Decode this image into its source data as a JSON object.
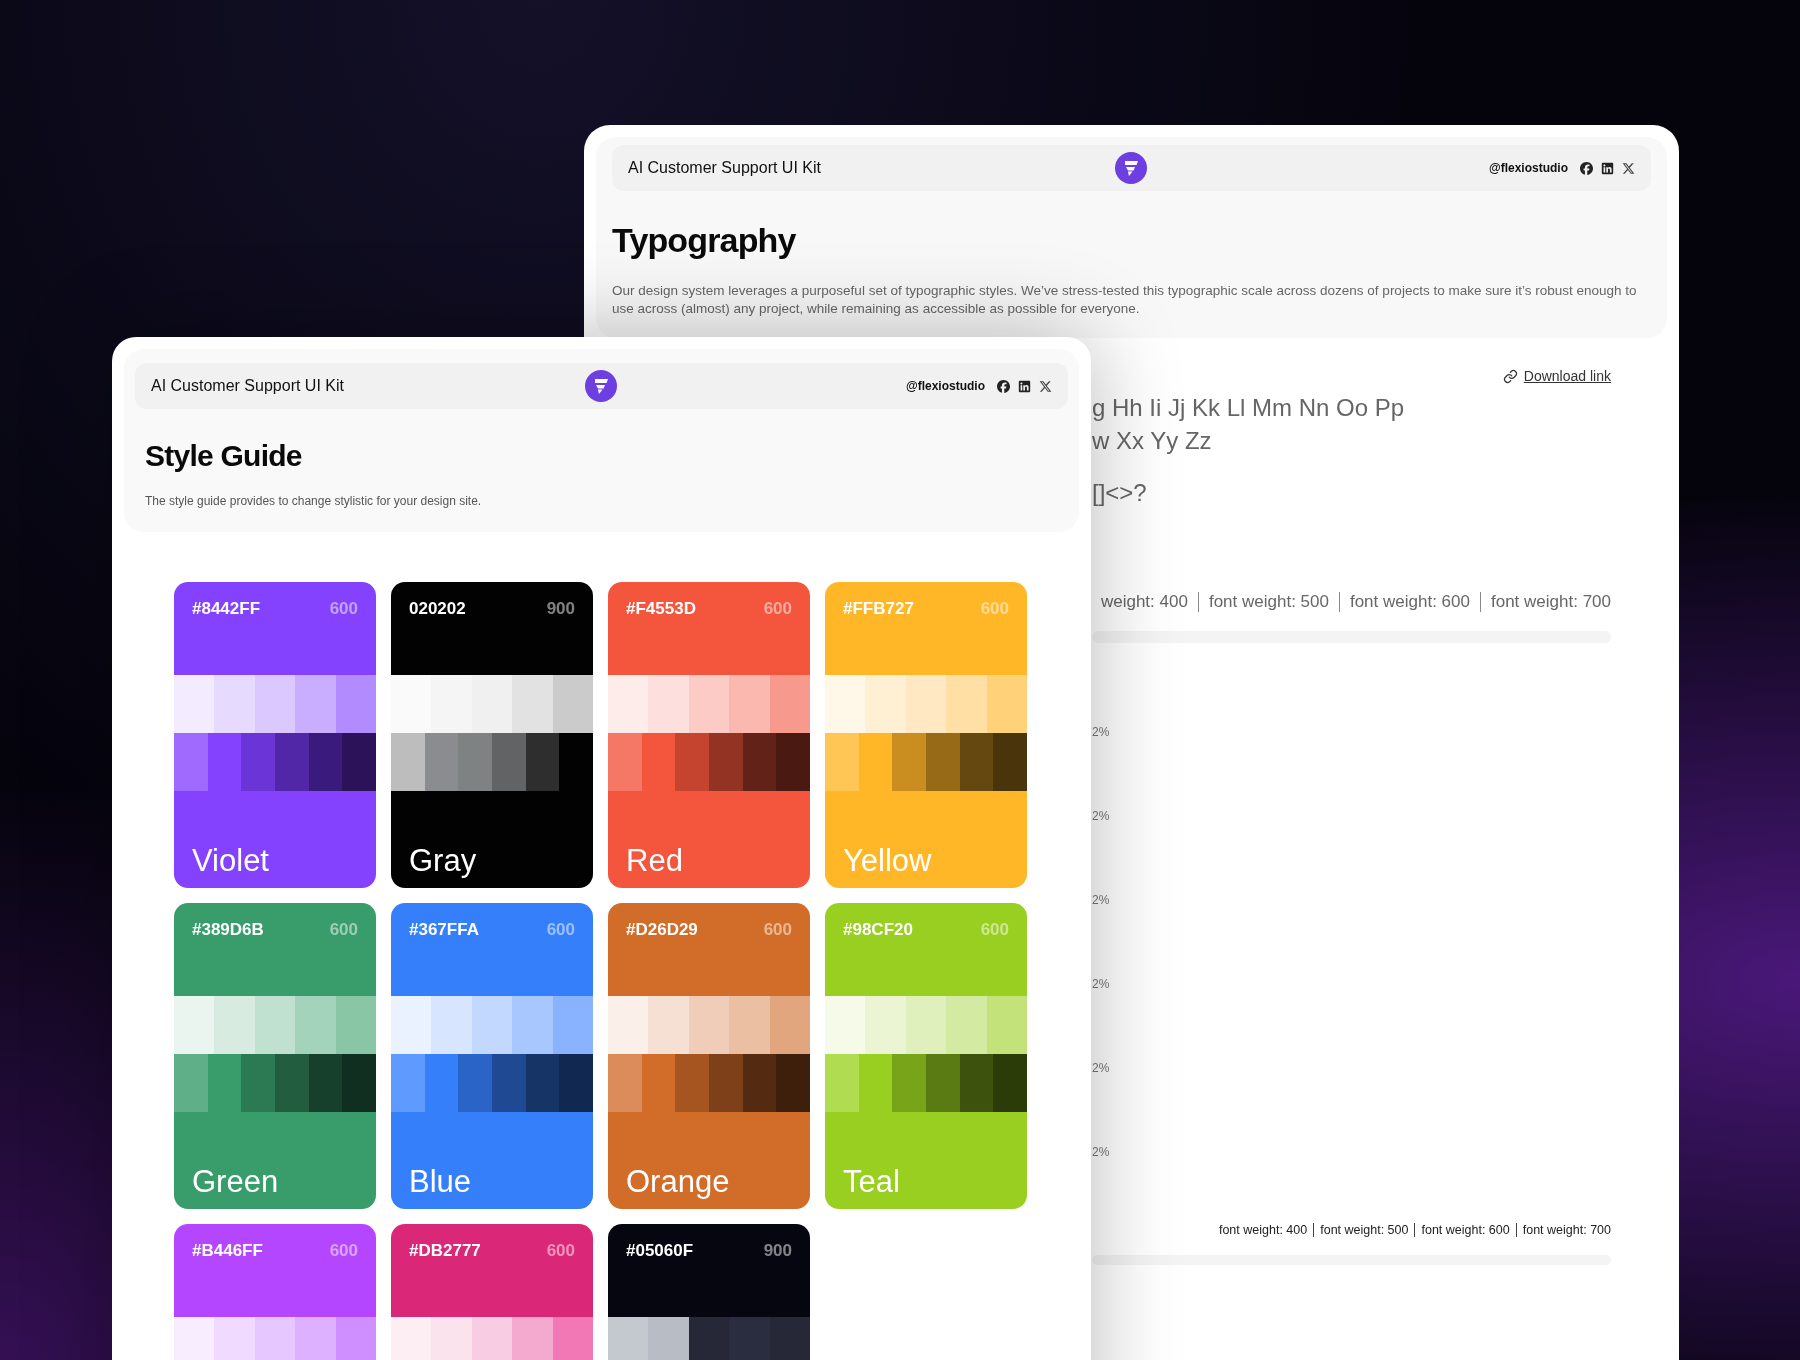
{
  "typography_window": {
    "header": {
      "title": "AI Customer Support UI Kit",
      "handle": "@flexiostudio"
    },
    "title": "Typography",
    "description": "Our design system leverages a purposeful set of typographic styles. We’ve stress-tested this typographic scale across dozens of projects to make sure it’s robust enough to use across (almost) any project, while remaining as accessible as possible for everyone.",
    "download_link": "Download link",
    "alphabet_lines": [
      "g Hh Ii Jj Kk Ll Mm Nn Oo Pp",
      "w Xx Yy Zz"
    ],
    "symbols": "[]<>?",
    "weights_large": [
      "weight: 400",
      "font weight: 500",
      "font weight: 600",
      "font weight: 700"
    ],
    "scale_percentages": [
      "2%",
      "2%",
      "2%",
      "2%",
      "2%",
      "2%"
    ],
    "weights_small": [
      "font weight: 400",
      "font weight: 500",
      "font weight: 600",
      "font weight: 700"
    ]
  },
  "style_guide_window": {
    "header": {
      "title": "AI Customer Support UI Kit",
      "handle": "@flexiostudio"
    },
    "title": "Style Guide",
    "description": "The style guide provides to change stylistic for your design site.",
    "swatches": [
      {
        "hex": "#8442FF",
        "weight": "600",
        "name": "Violet",
        "color": "#8442ff",
        "light_shades": [
          {
            "color": "#f3ebff"
          },
          {
            "color": "#e6daff"
          },
          {
            "color": "#dac8ff"
          },
          {
            "color": "#c9aeff"
          },
          {
            "color": "#b28cff"
          }
        ],
        "dark_shades": [
          {
            "color": "#a06aff"
          },
          {
            "color": "#8442ff"
          },
          {
            "color": "#6b34d6"
          },
          {
            "color": "#5127a8"
          },
          {
            "color": "#3b1a7d"
          },
          {
            "color": "#2b1259"
          }
        ]
      },
      {
        "hex": "020202",
        "weight": "900",
        "name": "Gray",
        "color": "#020202",
        "light_shades": [
          {
            "color": "#fafafa"
          },
          {
            "color": "#f5f5f5"
          },
          {
            "color": "#f0f0f0"
          },
          {
            "color": "#e2e2e2"
          },
          {
            "color": "#cbcbcb"
          }
        ],
        "dark_shades": [
          {
            "color": "#bdbdbd"
          },
          {
            "color": "#8a8c90"
          },
          {
            "color": "#7f8282"
          },
          {
            "color": "#626364"
          },
          {
            "color": "#2e2e2e"
          },
          {
            "color": "#020202"
          }
        ]
      },
      {
        "hex": "#F4553D",
        "weight": "600",
        "name": "Red",
        "color": "#f4553d",
        "light_shades": [
          {
            "color": "#feeceb"
          },
          {
            "color": "#fde0dd"
          },
          {
            "color": "#fccbc6"
          },
          {
            "color": "#fab8ae"
          },
          {
            "color": "#f7998c"
          }
        ],
        "dark_shades": [
          {
            "color": "#f57765"
          },
          {
            "color": "#f4553d"
          },
          {
            "color": "#c44430"
          },
          {
            "color": "#923324"
          },
          {
            "color": "#622218"
          },
          {
            "color": "#4a1912"
          }
        ]
      },
      {
        "hex": "#FFB727",
        "weight": "600",
        "name": "Yellow",
        "color": "#ffb727",
        "light_shades": [
          {
            "color": "#fff8e8"
          },
          {
            "color": "#fff0d4"
          },
          {
            "color": "#ffe8c2"
          },
          {
            "color": "#ffdfa4"
          },
          {
            "color": "#ffd27a"
          }
        ],
        "dark_shades": [
          {
            "color": "#ffc655"
          },
          {
            "color": "#ffb727"
          },
          {
            "color": "#c98e1f"
          },
          {
            "color": "#966a17"
          },
          {
            "color": "#654710"
          },
          {
            "color": "#4a340b"
          }
        ]
      },
      {
        "hex": "#389D6B",
        "weight": "600",
        "name": "Green",
        "color": "#389d6b",
        "light_shades": [
          {
            "color": "#ebf5ef"
          },
          {
            "color": "#d7ebe1"
          },
          {
            "color": "#c0e1d0"
          },
          {
            "color": "#a4d3bb"
          },
          {
            "color": "#88c6a6"
          }
        ],
        "dark_shades": [
          {
            "color": "#5fb088"
          },
          {
            "color": "#389d6b"
          },
          {
            "color": "#2b7a53"
          },
          {
            "color": "#225d40"
          },
          {
            "color": "#17402c"
          },
          {
            "color": "#112f20"
          }
        ]
      },
      {
        "hex": "#367FFA",
        "weight": "600",
        "name": "Blue",
        "color": "#367ffa",
        "light_shades": [
          {
            "color": "#ebf2ff"
          },
          {
            "color": "#d7e5ff"
          },
          {
            "color": "#c3d8ff"
          },
          {
            "color": "#a8c7ff"
          },
          {
            "color": "#89b2ff"
          }
        ],
        "dark_shades": [
          {
            "color": "#5e9aff"
          },
          {
            "color": "#367ffa"
          },
          {
            "color": "#2a64c6"
          },
          {
            "color": "#1f4a93"
          },
          {
            "color": "#163566"
          },
          {
            "color": "#112850"
          }
        ]
      },
      {
        "hex": "#D26D29",
        "weight": "600",
        "name": "Orange",
        "color": "#d26d29",
        "light_shades": [
          {
            "color": "#fbefe9"
          },
          {
            "color": "#f6e0d3"
          },
          {
            "color": "#f0cdb8"
          },
          {
            "color": "#eabfa2"
          },
          {
            "color": "#e2a67e"
          }
        ],
        "dark_shades": [
          {
            "color": "#dc8b5a"
          },
          {
            "color": "#d26d29"
          },
          {
            "color": "#a75520"
          },
          {
            "color": "#7d4018"
          },
          {
            "color": "#542b10"
          },
          {
            "color": "#3d1f0b"
          }
        ]
      },
      {
        "hex": "#98CF20",
        "weight": "600",
        "name": "Teal",
        "color": "#98cf20",
        "light_shades": [
          {
            "color": "#f6fae9"
          },
          {
            "color": "#ebf5d3"
          },
          {
            "color": "#e0f0bd"
          },
          {
            "color": "#d3eaa2"
          },
          {
            "color": "#c3e37a"
          }
        ],
        "dark_shades": [
          {
            "color": "#b0dc52"
          },
          {
            "color": "#98cf20"
          },
          {
            "color": "#78a419"
          },
          {
            "color": "#5a7b13"
          },
          {
            "color": "#3c520d"
          },
          {
            "color": "#2c3c09"
          }
        ]
      },
      {
        "hex": "#B446FF",
        "weight": "600",
        "color": "#b446ff",
        "light_shades": [
          {
            "color": "#f8ecff"
          },
          {
            "color": "#f0daff"
          },
          {
            "color": "#e7c7ff"
          },
          {
            "color": "#ddb1ff"
          },
          {
            "color": "#d08fff"
          }
        ]
      },
      {
        "hex": "#DB2777",
        "weight": "600",
        "color": "#db2777",
        "light_shades": [
          {
            "color": "#fdeef4"
          },
          {
            "color": "#fbe3ee"
          },
          {
            "color": "#f8cde3"
          },
          {
            "color": "#f4a9cf"
          },
          {
            "color": "#f177b5"
          }
        ]
      },
      {
        "hex": "#05060F",
        "weight": "900",
        "color": "#05060f",
        "light_shades": [
          {
            "color": "#c4c8cf"
          },
          {
            "color": "#b7bcc5"
          },
          {
            "color": "#262838"
          },
          {
            "color": "#2a2c40"
          },
          {
            "color": "#262837"
          }
        ]
      }
    ]
  }
}
